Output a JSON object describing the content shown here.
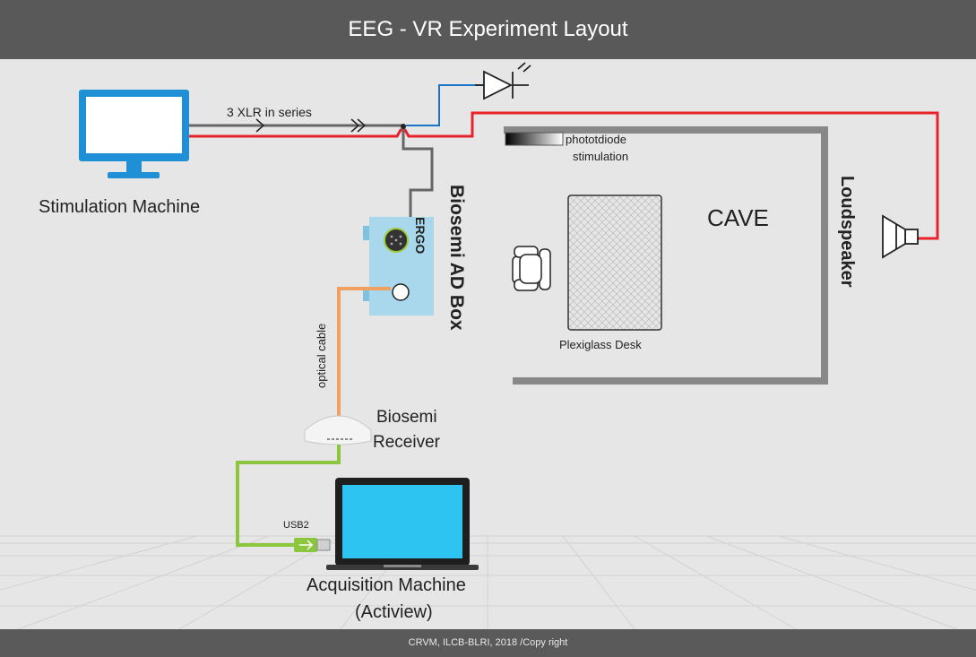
{
  "title": "EEG - VR Experiment Layout",
  "footer": "CRVM, ILCB-BLRI, 2018 /Copy right",
  "labels": {
    "stimulation_machine": "Stimulation Machine",
    "xlr": "3 XLR in series",
    "photodiode_line1": "phototdiode",
    "photodiode_line2": "stimulation",
    "cave": "CAVE",
    "plexiglass_desk": "Plexiglass Desk",
    "loudspeaker": "Loudspeaker",
    "biosemi_ad_box": "Biosemi AD Box",
    "ergo": "ERGO",
    "optical_cable": "optical cable",
    "biosemi_receiver_line1": "Biosemi",
    "biosemi_receiver_line2": "Receiver",
    "usb2": "USB2",
    "acquisition_machine_line1": "Acquisition Machine",
    "acquisition_machine_line2": "(Actiview)"
  },
  "colors": {
    "title_bar": "#595959",
    "audio_cable": "#e8212b",
    "trigger_cable": "#1a73c7",
    "ergo_cable": "#707070",
    "optical_cable": "#f0a060",
    "usb_cable": "#8cc63f",
    "monitor": "#1f8fd6",
    "laptop_screen": "#2ec4f1",
    "ad_box": "#a9d8ec",
    "cave_wall": "#888888"
  },
  "icons": [
    "monitor-icon",
    "photodiode-icon",
    "chair-icon",
    "loudspeaker-icon",
    "laptop-icon",
    "receiver-icon",
    "usb-plug-icon"
  ]
}
